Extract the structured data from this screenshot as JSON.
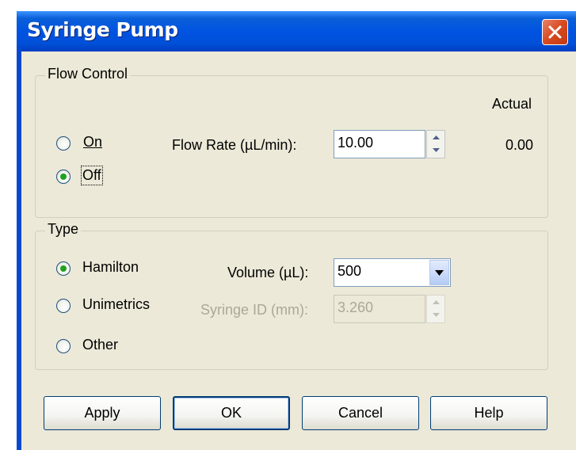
{
  "window": {
    "title": "Syringe Pump"
  },
  "flow_control": {
    "group_label": "Flow Control",
    "actual_header": "Actual",
    "on_label": "On",
    "off_label": "Off",
    "selected": "Off",
    "flow_rate_label": "Flow Rate (µL/min):",
    "flow_rate_value": "10.00",
    "actual_value": "0.00"
  },
  "type": {
    "group_label": "Type",
    "hamilton_label": "Hamilton",
    "unimetrics_label": "Unimetrics",
    "other_label": "Other",
    "selected": "Hamilton",
    "volume_label": "Volume (µL):",
    "volume_value": "500",
    "syringe_id_label": "Syringe ID (mm):",
    "syringe_id_value": "3.260"
  },
  "buttons": {
    "apply": "Apply",
    "ok": "OK",
    "cancel": "Cancel",
    "help": "Help"
  }
}
